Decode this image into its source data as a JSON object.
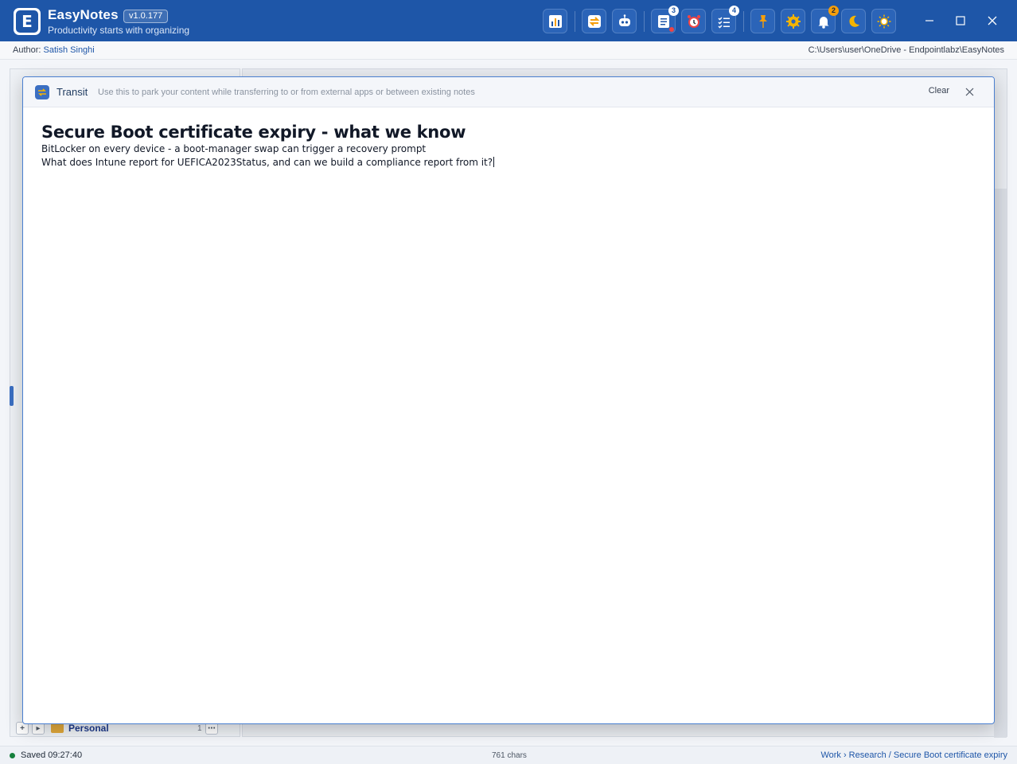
{
  "app": {
    "name": "EasyNotes",
    "version": "v1.0.177",
    "tagline": "Productivity starts with organizing",
    "logo_letter": "E"
  },
  "toolbar": {
    "buttons": [
      {
        "name": "dashboard",
        "icon": "chart-icon"
      },
      {
        "name": "transit",
        "icon": "transfer-icon"
      },
      {
        "name": "ai-assistant",
        "icon": "robot-icon"
      },
      {
        "name": "tasks-list",
        "icon": "list-icon",
        "badge": "3"
      },
      {
        "name": "reminders",
        "icon": "alarm-clock-icon"
      },
      {
        "name": "checklist",
        "icon": "checklist-icon",
        "badge": "4"
      },
      {
        "name": "pin",
        "icon": "pin-icon"
      },
      {
        "name": "settings",
        "icon": "gear-icon"
      },
      {
        "name": "notifications",
        "icon": "bell-icon",
        "badge": "2"
      },
      {
        "name": "dark-mode",
        "icon": "moon-icon"
      },
      {
        "name": "light-mode",
        "icon": "sun-icon"
      }
    ]
  },
  "authorbar": {
    "label": "Author:",
    "author": "Satish Singhi",
    "path": "C:\\Users\\user\\OneDrive - Endpointlabz\\EasyNotes"
  },
  "sidebar": {
    "folder_name": "Personal",
    "folder_count": "1"
  },
  "transit": {
    "title": "Transit",
    "hint": "Use this to park your content while transferring to or from external apps or between existing notes",
    "clear_label": "Clear",
    "heading": "Secure Boot certificate expiry - what we know",
    "lines": [
      "BitLocker on every device - a boot-manager swap can trigger a recovery prompt",
      "What does Intune report for UEFICA2023Status, and can we build a compliance report from it?"
    ]
  },
  "status": {
    "saved": "Saved 09:27:40",
    "chars": "761 chars",
    "breadcrumb": "Work › Research / Secure Boot certificate expiry"
  },
  "colors": {
    "brand": "#1e56a8",
    "accent": "#3b6fc2",
    "saved_dot": "#16803c",
    "badge_orange": "#f59e0b"
  }
}
